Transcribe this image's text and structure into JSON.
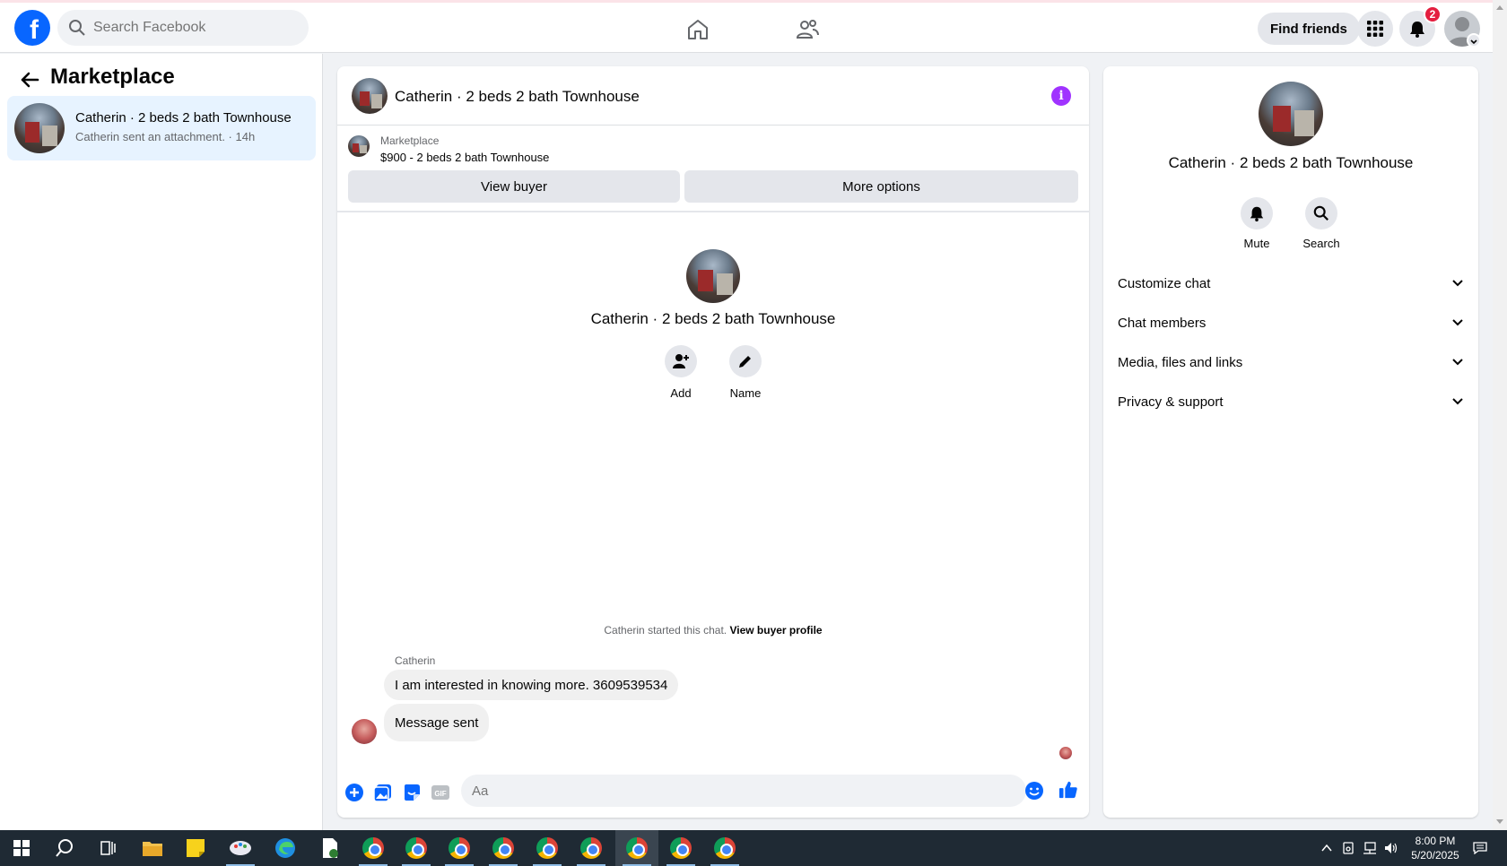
{
  "topbar": {
    "logo": "f",
    "search_placeholder": "Search Facebook",
    "find_friends": "Find friends",
    "notification_count": "2"
  },
  "sidebar": {
    "title": "Marketplace",
    "conversations": [
      {
        "name": "Catherin · 2 beds 2 bath Townhouse",
        "subtitle": "Catherin sent an attachment. · 14h"
      }
    ]
  },
  "chat": {
    "title": "Catherin · 2 beds 2 bath Townhouse",
    "marketplace_label": "Marketplace",
    "listing": "$900 - 2 beds 2 bath Townhouse",
    "view_buyer": "View buyer",
    "more_options": "More options",
    "center_title": "Catherin · 2 beds 2 bath Townhouse",
    "add_label": "Add",
    "name_label": "Name",
    "started_text": "Catherin started this chat.",
    "view_buyer_profile": "View buyer profile",
    "sender": "Catherin",
    "messages": [
      "I am interested in knowing more. 3609539534",
      "Message sent"
    ],
    "composer_placeholder": "Aa",
    "gif_label": "GIF"
  },
  "details": {
    "title": "Catherin · 2 beds 2 bath Townhouse",
    "mute_label": "Mute",
    "search_label": "Search",
    "rows": [
      "Customize chat",
      "Chat members",
      "Media, files and links",
      "Privacy & support"
    ]
  },
  "taskbar": {
    "time": "8:00 PM",
    "date": "5/20/2025"
  },
  "colors": {
    "brand": "#0866ff",
    "info": "#a033ff",
    "selected_bg": "#e7f3ff",
    "badge": "#e41e3f"
  }
}
